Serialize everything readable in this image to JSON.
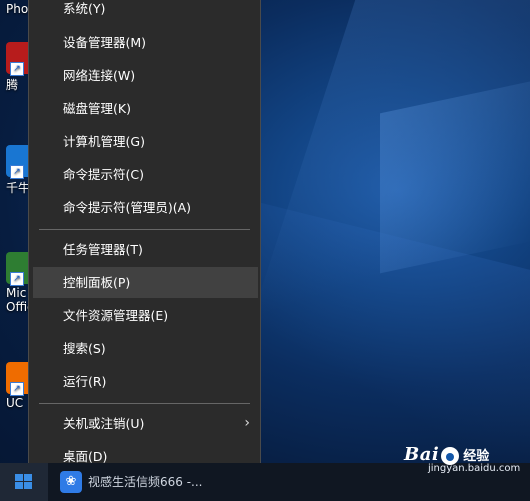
{
  "desktop_icons": [
    {
      "name": "desktop-icon-pho",
      "label": "Pho",
      "color": "#c62828"
    },
    {
      "name": "desktop-icon-teng",
      "label": "腾",
      "color": "#1e88e5"
    },
    {
      "name": "desktop-icon-qianniu",
      "label": "千牛",
      "color": "#1976d2"
    },
    {
      "name": "desktop-icon-office",
      "label": "Mic\nOffic",
      "color": "#2e7d32"
    },
    {
      "name": "desktop-icon-uc",
      "label": "UC",
      "color": "#ef6c00"
    }
  ],
  "menu": {
    "items": [
      {
        "label": "系统(Y)"
      },
      {
        "label": "设备管理器(M)"
      },
      {
        "label": "网络连接(W)"
      },
      {
        "label": "磁盘管理(K)"
      },
      {
        "label": "计算机管理(G)"
      },
      {
        "label": "命令提示符(C)"
      },
      {
        "label": "命令提示符(管理员)(A)"
      },
      {
        "label": "任务管理器(T)"
      },
      {
        "label": "控制面板(P)"
      },
      {
        "label": "文件资源管理器(E)"
      },
      {
        "label": "搜索(S)"
      },
      {
        "label": "运行(R)"
      },
      {
        "label": "关机或注销(U)"
      },
      {
        "label": "桌面(D)"
      }
    ],
    "submenu_arrow": "›"
  },
  "taskbar": {
    "app_text": "视感生活信频666 -..."
  },
  "watermark": {
    "brand_a": "Bai",
    "brand_b": "经验",
    "url": "jingyan.baidu.com"
  }
}
